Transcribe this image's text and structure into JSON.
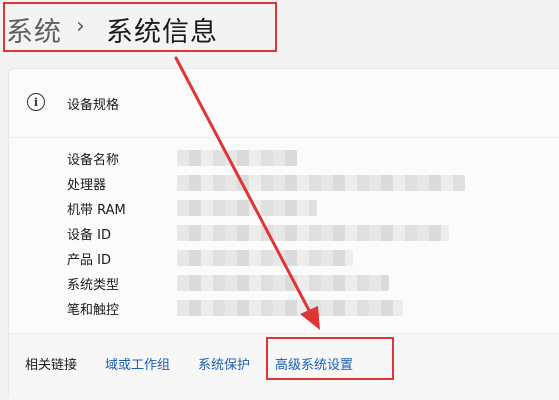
{
  "breadcrumb": {
    "parent": "系统",
    "separator": "›",
    "current": "系统信息"
  },
  "device_specs": {
    "icon": "info-icon",
    "title": "设备规格",
    "rows": [
      {
        "label": "设备名称"
      },
      {
        "label": "处理器"
      },
      {
        "label": "机带 RAM"
      },
      {
        "label": "设备 ID"
      },
      {
        "label": "产品 ID"
      },
      {
        "label": "系统类型"
      },
      {
        "label": "笔和触控"
      }
    ]
  },
  "related_links": {
    "label": "相关链接",
    "links": [
      {
        "label": "域或工作组"
      },
      {
        "label": "系统保护"
      },
      {
        "label": "高级系统设置"
      }
    ]
  },
  "annotation": {
    "color": "#e03535"
  }
}
